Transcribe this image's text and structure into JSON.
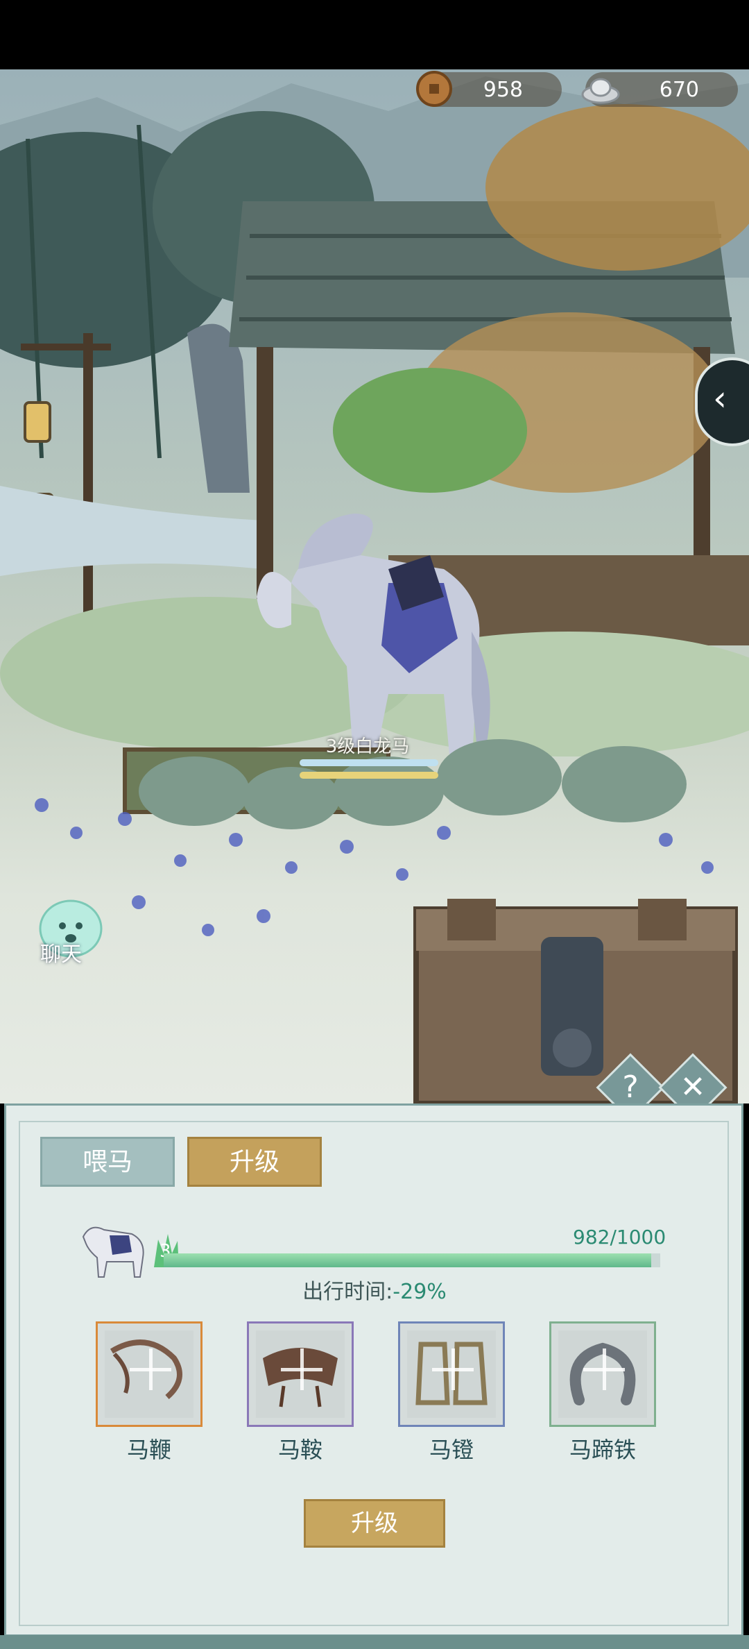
{
  "currency": {
    "copper": "958",
    "silver": "670"
  },
  "horse": {
    "name": "3级白龙马",
    "level": "3"
  },
  "chat": {
    "label": "聊天"
  },
  "panel": {
    "tabs": [
      {
        "label": "喂马"
      },
      {
        "label": "升级"
      }
    ],
    "active_tab": "升级",
    "xp": {
      "text": "982/1000",
      "current": 982,
      "max": 1000
    },
    "travel_time": {
      "label": "出行时间:",
      "value": "-29%"
    },
    "slots": [
      {
        "label": "马鞭",
        "border": "#d98a3a"
      },
      {
        "label": "马鞍",
        "border": "#8a78b8"
      },
      {
        "label": "马镫",
        "border": "#6f85b8"
      },
      {
        "label": "马蹄铁",
        "border": "#7fb08f"
      }
    ],
    "upgrade_button": "升级",
    "help_icon": "?",
    "close_icon": "✕"
  },
  "side_tab": {
    "icon": "chevron-left-icon"
  },
  "colors": {
    "accent_green": "#2a8a72",
    "gold": "#c4a15c",
    "panel_bg": "#e3ecea"
  }
}
